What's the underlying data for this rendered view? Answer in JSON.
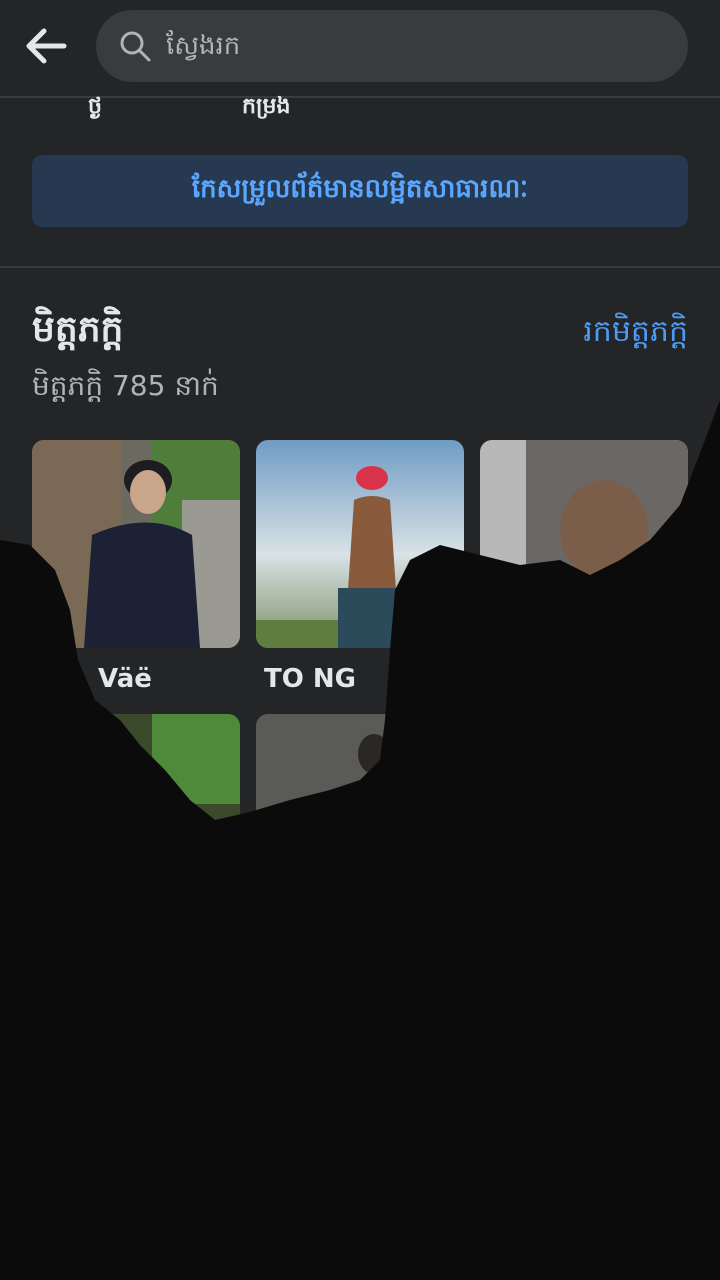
{
  "search": {
    "placeholder": "ស្វែងរក"
  },
  "partial_tabs": {
    "left": "ថ្ង",
    "right": "កម្រង"
  },
  "edit_public_details": {
    "label": "កែសម្រួលព័ត៌មានលម្អិតសាធារណៈ"
  },
  "friends": {
    "title": "មិត្តភក្តិ",
    "find_link": "រកមិត្តភក្តិ",
    "count": "មិត្តភក្តិ 785 នាក់",
    "cards": [
      {
        "name": "Väë"
      },
      {
        "name": "TO NG"
      },
      {
        "name": ""
      },
      {
        "name": ""
      },
      {
        "name": ""
      },
      {
        "name": ""
      }
    ]
  },
  "colors": {
    "background": "#242526",
    "accent_link": "#4e9bf5",
    "button_bg": "#263951",
    "button_text": "#5aa7ff"
  },
  "icons": [
    "back-arrow-icon",
    "search-icon"
  ]
}
